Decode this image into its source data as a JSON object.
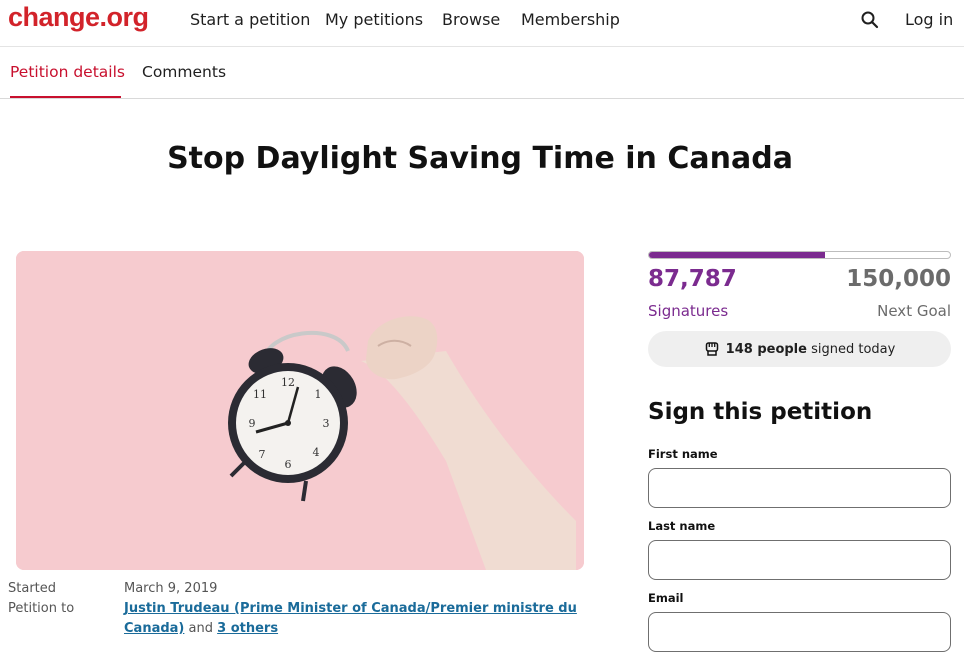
{
  "brand": {
    "logo": "change.org",
    "accent": "#d2232a"
  },
  "nav": {
    "items": [
      {
        "label": "Start a petition"
      },
      {
        "label": "My petitions"
      },
      {
        "label": "Browse"
      },
      {
        "label": "Membership"
      }
    ],
    "search_icon": "search-icon",
    "login": "Log in"
  },
  "tabs": [
    {
      "label": "Petition details",
      "active": true
    },
    {
      "label": "Comments",
      "active": false
    }
  ],
  "petition": {
    "title": "Stop Daylight Saving Time in Canada",
    "image_icon": "alarm-clock-photo",
    "started_label": "Started",
    "started_date": "March 9, 2019",
    "petition_to_label": "Petition to",
    "target_line1": "Justin Trudeau (Prime Minister of Canada/Premier ministre du",
    "target_line2": "Canada)",
    "and_text": "and",
    "others_link": "3 others"
  },
  "progress": {
    "signatures": "87,787",
    "signatures_label": "Signatures",
    "goal": "150,000",
    "goal_label": "Next Goal",
    "fraction": 0.5853,
    "color": "#7b2b8f"
  },
  "today": {
    "icon": "raised-fist-icon",
    "count_text": "148 people",
    "suffix": "signed today"
  },
  "sign_form": {
    "heading": "Sign this petition",
    "first_name_label": "First name",
    "last_name_label": "Last name",
    "email_label": "Email"
  }
}
